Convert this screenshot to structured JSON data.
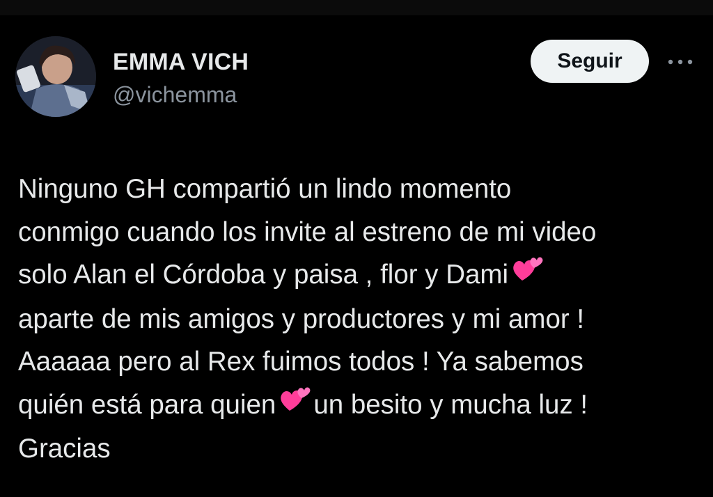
{
  "author": {
    "display_name": "EMMA VICH",
    "handle": "@vichemma",
    "avatar_icon": "profile-photo-avatar"
  },
  "actions": {
    "follow_label": "Seguir",
    "more_icon": "more-options-icon",
    "more_glyph": "•••"
  },
  "tweet": {
    "segments": [
      "Ninguno GH compartió un lindo momento",
      "conmigo cuando los invite al estreno de mi video",
      "solo Alan el Córdoba y paisa , flor y Dami",
      "aparte de mis amigos y productores y mi amor !",
      "Aaaaaa pero al Rex fuimos todos ! Ya sabemos",
      "quién está para quien",
      "un besito y mucha luz !",
      "Gracias"
    ],
    "emoji_icon": "two-hearts-emoji"
  },
  "colors": {
    "background": "#000000",
    "text_primary": "#e7e9ea",
    "text_secondary": "#8b949e",
    "button_bg": "#eff3f4",
    "heart_pink": "#ff4fa3"
  }
}
